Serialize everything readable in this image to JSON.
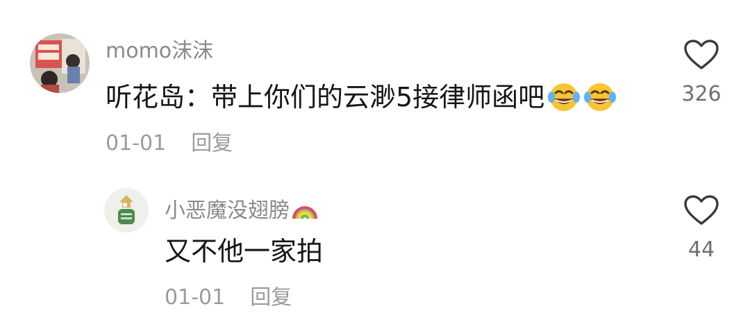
{
  "comments": [
    {
      "username": "momo沫沫",
      "text": "听花岛：带上你们的云渺5接律师函吧",
      "emojis": [
        "laugh-cry-emoji",
        "laugh-cry-emoji"
      ],
      "date": "01-01",
      "reply_label": "回复",
      "like_count": "326",
      "avatar_icon": "user-avatar-photo"
    },
    {
      "username": "小恶魔没翅膀",
      "username_suffix_icon": "rainbow-emoji",
      "text": "又不他一家拍",
      "date": "01-01",
      "reply_label": "回复",
      "like_count": "44",
      "avatar_icon": "user-avatar-illustration"
    }
  ],
  "colors": {
    "username": "#8a8a8a",
    "text": "#161616",
    "meta": "#9b9b9b",
    "heart_stroke": "#3a3a3a"
  }
}
